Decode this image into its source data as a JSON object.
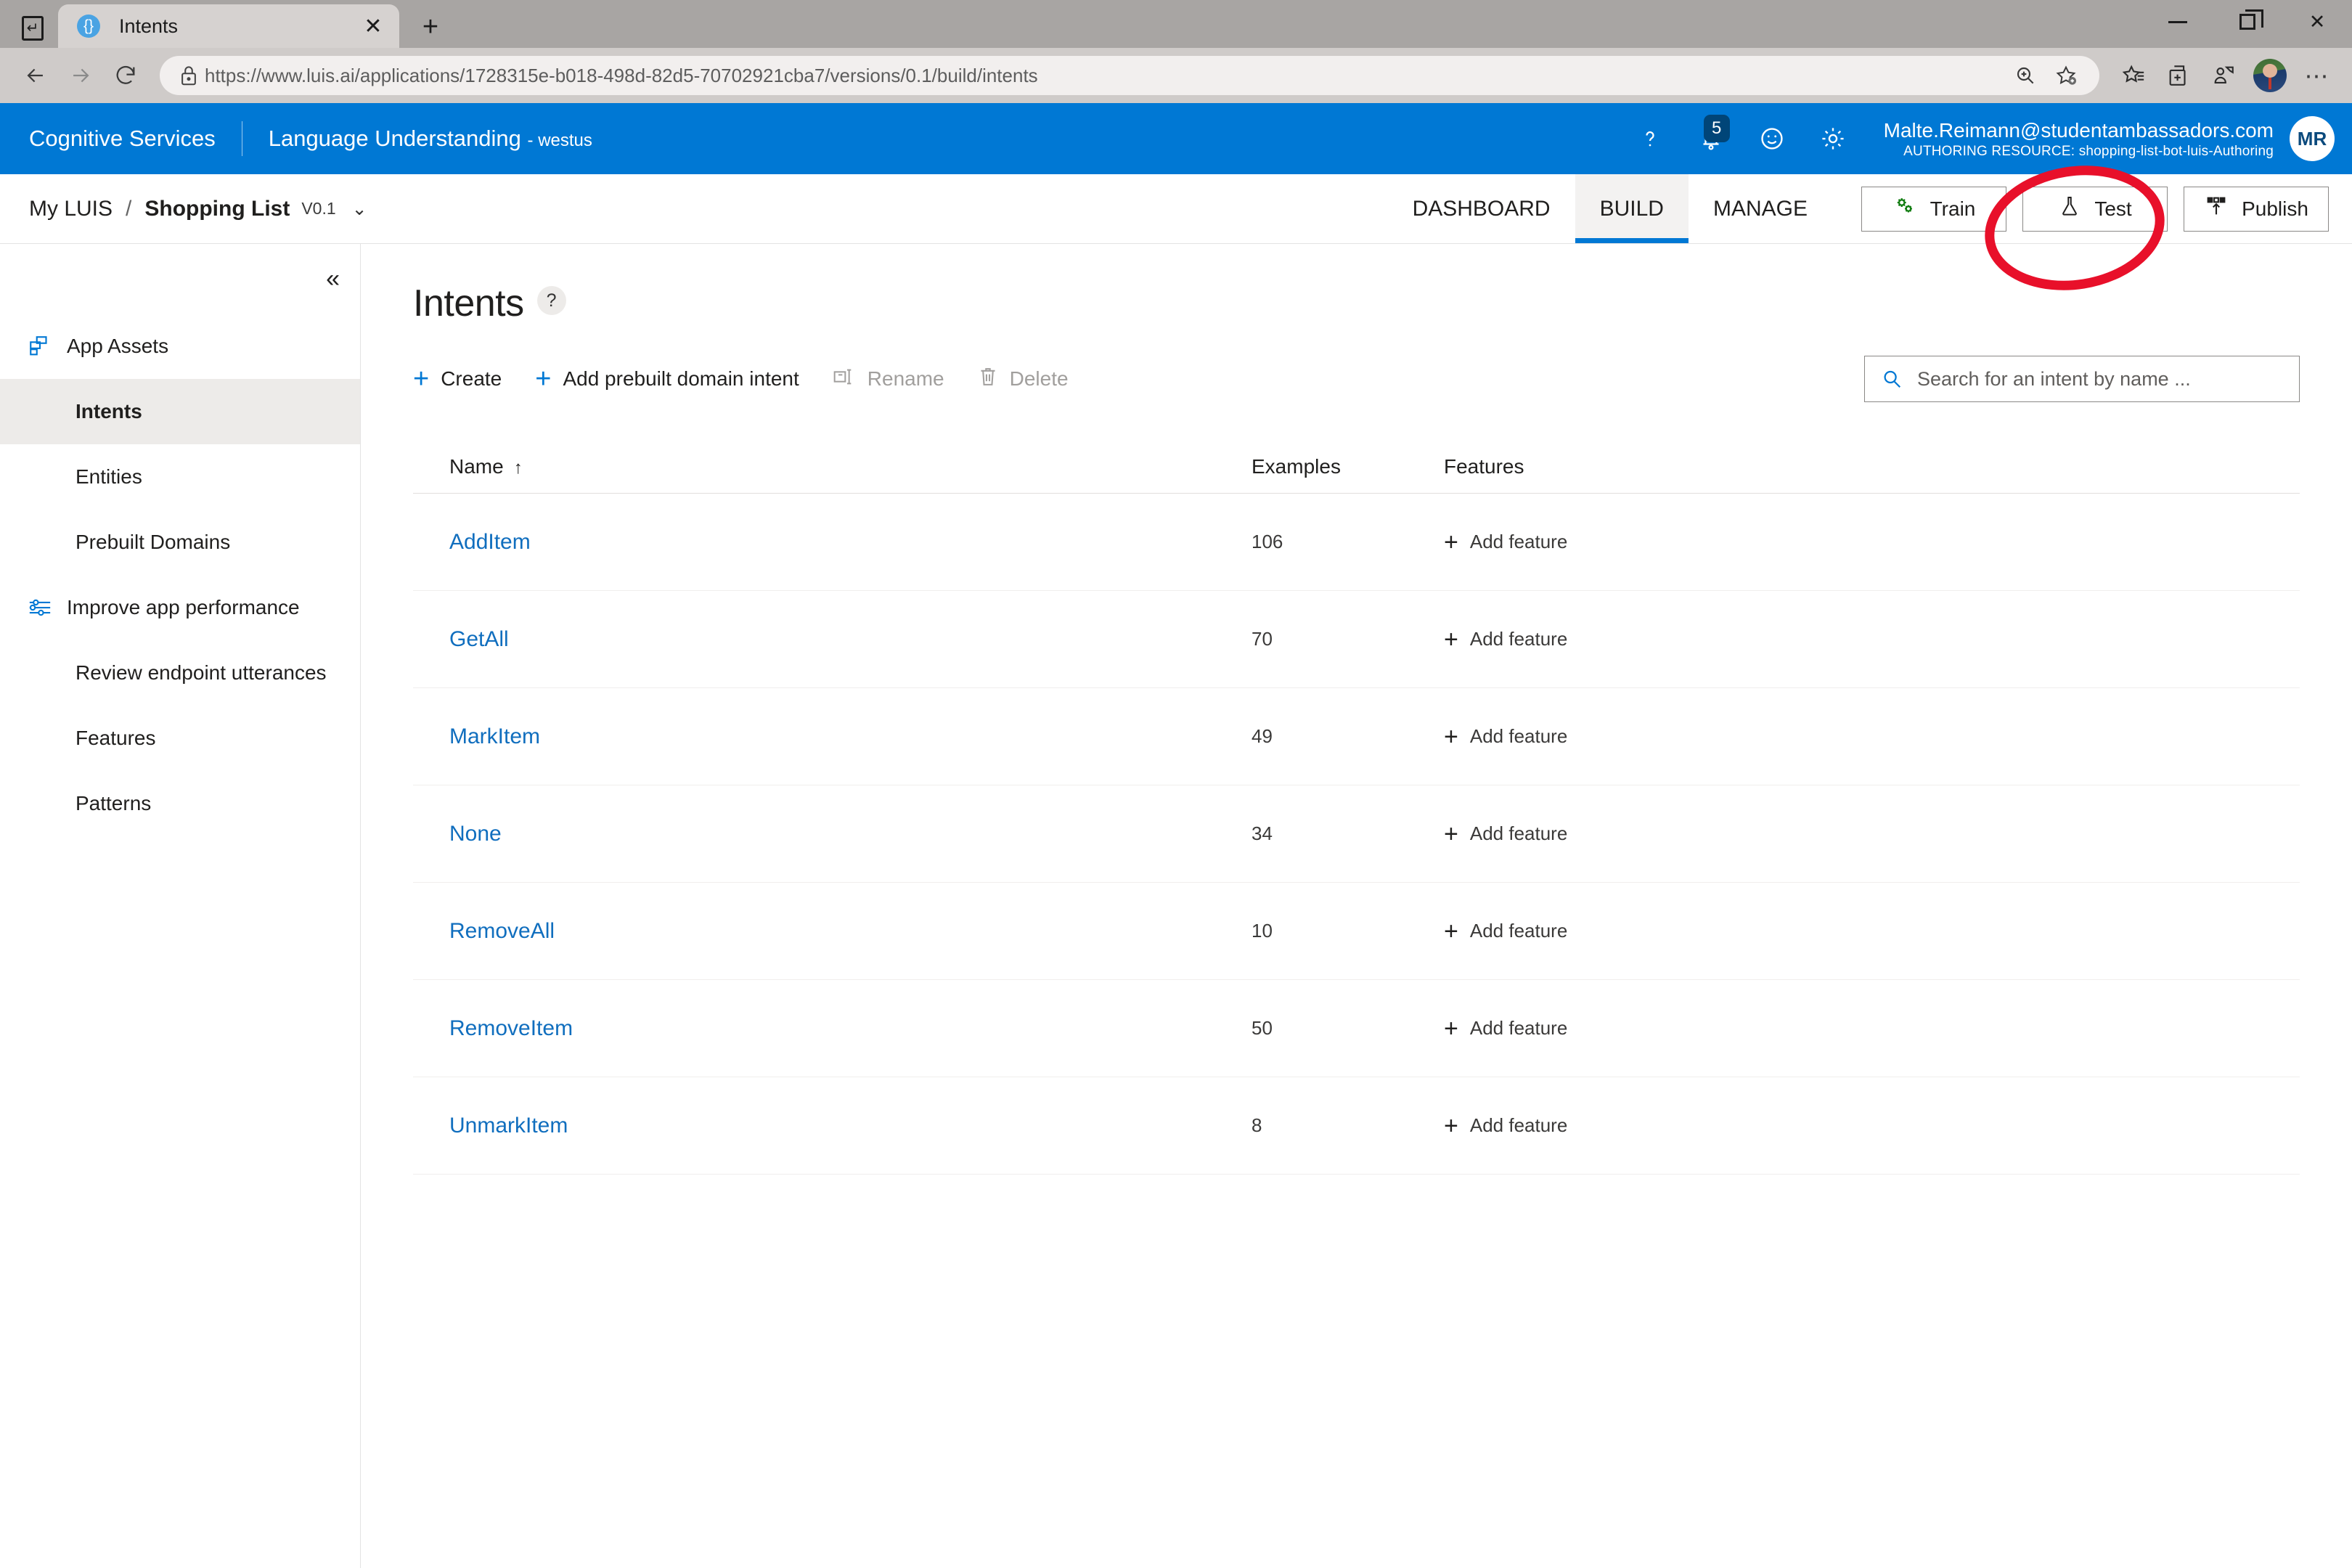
{
  "browser": {
    "tab": {
      "title": "Intents",
      "favicon_icon": "braces-icon",
      "close_icon": "close-icon"
    },
    "tab_manager_icon": "tab-manager-icon",
    "new_tab_icon": "plus-icon",
    "window_controls": {
      "minimize": "minimize-icon",
      "maximize": "restore-icon",
      "close": "close-icon"
    },
    "back_icon": "arrow-left-icon",
    "forward_icon": "arrow-right-icon",
    "reload_icon": "reload-icon",
    "lock_icon": "lock-icon",
    "url": "https://www.luis.ai/applications/1728315e-b018-498d-82d5-70702921cba7/versions/0.1/build/intents",
    "toolbar_icons": [
      "zoom-icon",
      "add-favorite-icon",
      "favorites-icon",
      "collections-icon",
      "share-icon",
      "profile-avatar",
      "more-icon"
    ]
  },
  "header": {
    "brand": "Cognitive Services",
    "product": "Language Understanding",
    "region": "- westus",
    "help_icon": "question-icon",
    "notifications_icon": "bell-icon",
    "notifications_count": "5",
    "feedback_icon": "smiley-icon",
    "settings_icon": "gear-icon",
    "user_email": "Malte.Reimann@studentambassadors.com",
    "authoring_resource_label": "AUTHORING RESOURCE:",
    "authoring_resource_name": "shopping-list-bot-luis-Authoring",
    "user_initials": "MR",
    "accent_color": "#0078d4",
    "badge_color": "#004578"
  },
  "appnav": {
    "breadcrumb_root": "My LUIS",
    "breadcrumb_sep": "/",
    "app_name": "Shopping List",
    "version": "V0.1",
    "version_chevron_icon": "chevron-down-icon",
    "tabs": [
      {
        "label": "DASHBOARD",
        "active": false
      },
      {
        "label": "BUILD",
        "active": true
      },
      {
        "label": "MANAGE",
        "active": false
      }
    ],
    "buttons": [
      {
        "label": "Train",
        "icon": "gears-icon"
      },
      {
        "label": "Test",
        "icon": "flask-icon"
      },
      {
        "label": "Publish",
        "icon": "publish-icon"
      }
    ]
  },
  "sidebar": {
    "collapse_icon": "chevron-double-left-icon",
    "groups": [
      {
        "label": "App Assets",
        "icon": "app-assets-icon",
        "items": [
          {
            "label": "Intents",
            "active": true
          },
          {
            "label": "Entities",
            "active": false
          },
          {
            "label": "Prebuilt Domains",
            "active": false
          }
        ]
      },
      {
        "label": "Improve app performance",
        "icon": "sliders-icon",
        "items": [
          {
            "label": "Review endpoint utterances",
            "active": false
          },
          {
            "label": "Features",
            "active": false
          },
          {
            "label": "Patterns",
            "active": false
          }
        ]
      }
    ]
  },
  "main": {
    "title": "Intents",
    "help_glyph": "?",
    "toolbar": [
      {
        "label": "Create",
        "icon": "plus-icon",
        "disabled": false
      },
      {
        "label": "Add prebuilt domain intent",
        "icon": "plus-icon",
        "disabled": false
      },
      {
        "label": "Rename",
        "icon": "rename-icon",
        "disabled": true
      },
      {
        "label": "Delete",
        "icon": "trash-icon",
        "disabled": true
      }
    ],
    "search": {
      "placeholder": "Search for an intent by name ...",
      "value": "",
      "icon": "search-icon"
    },
    "table": {
      "columns": [
        "Name",
        "Examples",
        "Features"
      ],
      "sort_column": "Name",
      "sort_direction_icon": "arrow-up-icon",
      "add_feature_label": "Add feature",
      "add_feature_icon": "plus-icon",
      "rows": [
        {
          "name": "AddItem",
          "examples": "106"
        },
        {
          "name": "GetAll",
          "examples": "70"
        },
        {
          "name": "MarkItem",
          "examples": "49"
        },
        {
          "name": "None",
          "examples": "34"
        },
        {
          "name": "RemoveAll",
          "examples": "10"
        },
        {
          "name": "RemoveItem",
          "examples": "50"
        },
        {
          "name": "UnmarkItem",
          "examples": "8"
        }
      ]
    }
  },
  "annotation": {
    "type": "ellipse-highlight",
    "target": "Test",
    "color": "#e8102a"
  }
}
